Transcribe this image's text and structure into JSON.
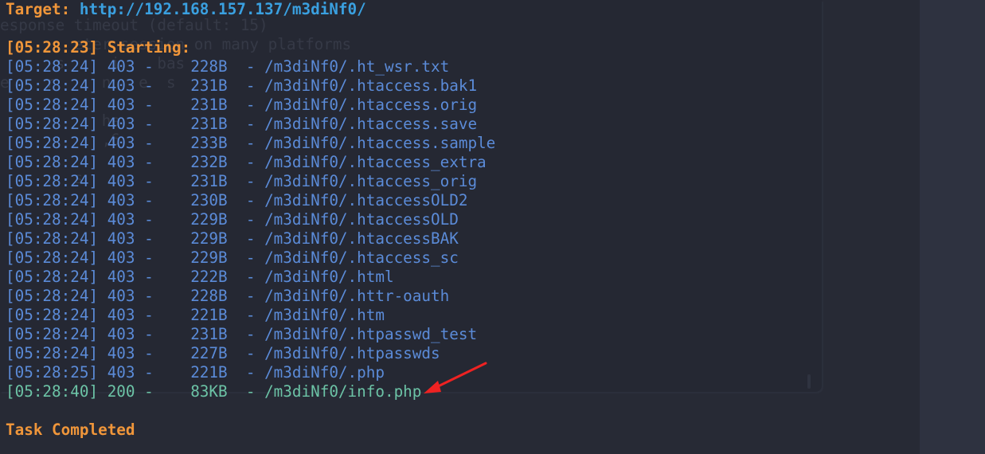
{
  "target": {
    "label": "Target:",
    "url": "http://192.168.157.137/m3diNf0/"
  },
  "background_text": [
    "esponse timeout (default: 15)",
    "        eter session on many platforms",
    "      s     i    bas",
    "e    r     n   e  s",
    "",
    "           he",
    "           ,6",
    "",
    "        s"
  ],
  "start": {
    "time": "[05:28:23]",
    "label": "Starting:"
  },
  "results": [
    {
      "time": "[05:28:24]",
      "status": "403",
      "size": "228B",
      "path": "/m3diNf0/.ht_wsr.txt"
    },
    {
      "time": "[05:28:24]",
      "status": "403",
      "size": "231B",
      "path": "/m3diNf0/.htaccess.bak1"
    },
    {
      "time": "[05:28:24]",
      "status": "403",
      "size": "231B",
      "path": "/m3diNf0/.htaccess.orig"
    },
    {
      "time": "[05:28:24]",
      "status": "403",
      "size": "231B",
      "path": "/m3diNf0/.htaccess.save"
    },
    {
      "time": "[05:28:24]",
      "status": "403",
      "size": "233B",
      "path": "/m3diNf0/.htaccess.sample"
    },
    {
      "time": "[05:28:24]",
      "status": "403",
      "size": "232B",
      "path": "/m3diNf0/.htaccess_extra"
    },
    {
      "time": "[05:28:24]",
      "status": "403",
      "size": "231B",
      "path": "/m3diNf0/.htaccess_orig"
    },
    {
      "time": "[05:28:24]",
      "status": "403",
      "size": "230B",
      "path": "/m3diNf0/.htaccessOLD2"
    },
    {
      "time": "[05:28:24]",
      "status": "403",
      "size": "229B",
      "path": "/m3diNf0/.htaccessOLD"
    },
    {
      "time": "[05:28:24]",
      "status": "403",
      "size": "229B",
      "path": "/m3diNf0/.htaccessBAK"
    },
    {
      "time": "[05:28:24]",
      "status": "403",
      "size": "229B",
      "path": "/m3diNf0/.htaccess_sc"
    },
    {
      "time": "[05:28:24]",
      "status": "403",
      "size": "222B",
      "path": "/m3diNf0/.html"
    },
    {
      "time": "[05:28:24]",
      "status": "403",
      "size": "228B",
      "path": "/m3diNf0/.httr-oauth"
    },
    {
      "time": "[05:28:24]",
      "status": "403",
      "size": "221B",
      "path": "/m3diNf0/.htm"
    },
    {
      "time": "[05:28:24]",
      "status": "403",
      "size": "231B",
      "path": "/m3diNf0/.htpasswd_test"
    },
    {
      "time": "[05:28:24]",
      "status": "403",
      "size": "227B",
      "path": "/m3diNf0/.htpasswds"
    },
    {
      "time": "[05:28:25]",
      "status": "403",
      "size": "221B",
      "path": "/m3diNf0/.php"
    },
    {
      "time": "[05:28:40]",
      "status": "200",
      "size": "83KB",
      "path": "/m3diNf0/info.php",
      "highlight": true
    }
  ],
  "completed": "Task Completed",
  "colors": {
    "background": "#272a35",
    "accent_orange": "#f0963a",
    "url_blue": "#3aa0e0",
    "status_403": "#5b8bd8",
    "status_200": "#6cc3a6",
    "arrow_red": "#ee2222"
  },
  "annotation": {
    "icon": "red-arrow-icon"
  }
}
